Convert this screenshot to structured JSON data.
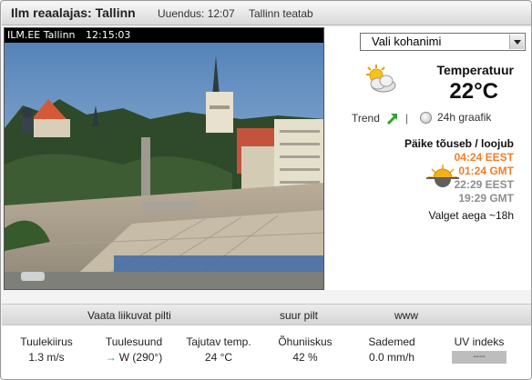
{
  "header": {
    "title": "Ilm reaalajas: Tallinn",
    "updated": "Uuendus: 12:07",
    "report": "Tallinn teatab"
  },
  "webcam": {
    "label": "ILM.EE Tallinn",
    "time": "12:15:03"
  },
  "location_select": {
    "value": "Vali kohanimi"
  },
  "weather": {
    "icon": "partly-cloudy-icon",
    "temperature_label": "Temperatuur",
    "temperature_value": "22°C",
    "trend_label": "Trend",
    "trend_direction": "up",
    "separator": "|",
    "graph_label": "24h graafik"
  },
  "sun": {
    "title": "Päike tõuseb / loojub",
    "rise_local": "04:24 EEST",
    "rise_gmt": "01:24 GMT",
    "set_local": "22:29 EEST",
    "set_gmt": "19:29 GMT",
    "daylight": "Valget aega ~18h"
  },
  "links": {
    "moving_picture": "Vaata liikuvat pilti",
    "big_picture": "suur pilt",
    "www": "www"
  },
  "stats": [
    {
      "label": "Tuulekiirus",
      "value": "1.3 m/s"
    },
    {
      "label": "Tuulesuund",
      "value": "W (290°)",
      "arrow": "→"
    },
    {
      "label": "Tajutav temp.",
      "value": "24 °C"
    },
    {
      "label": "Õhuniiskus",
      "value": "42 %"
    },
    {
      "label": "Sademed",
      "value": "0.0 mm/h"
    },
    {
      "label": "UV indeks",
      "value": "----"
    }
  ],
  "colors": {
    "sunrise": "#ef7f2a",
    "sunset": "#8d8d8d",
    "trend_arrow": "#2aa52a"
  }
}
